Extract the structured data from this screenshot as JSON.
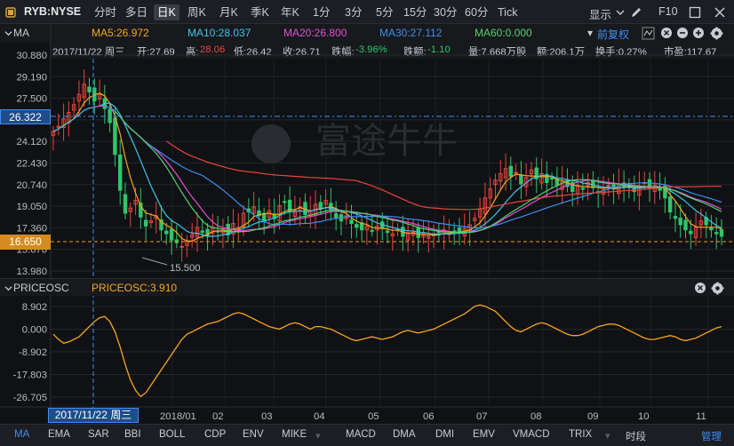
{
  "toolbar": {
    "symbol": "RYB:NYSE",
    "periods": [
      "分时",
      "多日",
      "日K",
      "周K",
      "月K",
      "季K",
      "年K",
      "1分",
      "3分",
      "5分",
      "15分",
      "30分",
      "60分",
      "Tick"
    ],
    "active_period": "日K",
    "display_label": "显示",
    "f10_label": "F10"
  },
  "ma_panel": {
    "label": "MA",
    "ma5": "MA5:26.972",
    "ma10": "MA10:28.037",
    "ma20": "MA20:26.800",
    "ma30": "MA30:27.112",
    "ma60": "MA60:0.000",
    "adjust": "前复权",
    "colors": {
      "ma5": "#f5a623",
      "ma10": "#3cc6e8",
      "ma20": "#e352d2",
      "ma30": "#3d8ef0",
      "ma60": "#53d26c",
      "up": "#e8453c",
      "down": "#2fc56b"
    }
  },
  "info": {
    "date": "2017/11/22 周三",
    "open": "开:27.69",
    "high_label": "高:",
    "high": "28.06",
    "low": "低:26.42",
    "close": "收:26.71",
    "change_pct_label": "跌幅:",
    "change_pct": "-3.96%",
    "change_label": "跌额:",
    "change": "-1.10",
    "volume": "量:7.668万股",
    "amount": "额:206.1万",
    "turnover": "换手:0.27%",
    "pe": "市盈:117.67"
  },
  "price_axis": [
    "30.880",
    "29.190",
    "27.500",
    "25.810",
    "24.120",
    "22.430",
    "20.740",
    "19.050",
    "17.360",
    "15.670",
    "13.980"
  ],
  "crosshair_price": "26.322",
  "last_price": "16.650",
  "low_annotation": "15.500",
  "osc_panel": {
    "label": "PRICEOSC",
    "value": "PRICEOSC:3.910",
    "axis": [
      "8.902",
      "0.000",
      "-8.902",
      "-17.803",
      "-26.705"
    ],
    "color": "#f5a623"
  },
  "time_axis": {
    "crosshair_date": "2017/11/22 周三",
    "labels": [
      "2018/01",
      "02",
      "03",
      "04",
      "05",
      "06",
      "07",
      "08",
      "09",
      "10",
      "11"
    ]
  },
  "indicators": [
    "MA",
    "EMA",
    "SAR",
    "BBI",
    "BOLL",
    "CDP",
    "ENV",
    "MIKE",
    "MACD",
    "DMA",
    "DMI",
    "EMV",
    "VMACD",
    "TRIX",
    "时段"
  ],
  "active_indicator": "MA",
  "manage_label": "管理",
  "watermark": "富途牛牛",
  "chart_data": {
    "type": "line",
    "ylim": [
      13.98,
      30.88
    ],
    "osc_ylim": [
      -26.705,
      8.902
    ],
    "close_series": [
      24.9,
      25.3,
      25.9,
      26.4,
      27.0,
      27.8,
      28.6,
      28.0,
      27.3,
      27.8,
      26.7,
      25.6,
      23.1,
      20.3,
      18.5,
      18.9,
      19.5,
      18.2,
      17.5,
      17.9,
      18.3,
      17.2,
      16.9,
      16.4,
      16.2,
      15.9,
      16.3,
      16.8,
      17.4,
      17.0,
      16.7,
      17.4,
      17.1,
      17.3,
      16.8,
      17.7,
      17.4,
      18.5,
      18.6,
      19.0,
      18.3,
      17.9,
      18.7,
      18.1,
      19.1,
      19.4,
      18.6,
      18.7,
      19.0,
      18.4,
      18.7,
      19.2,
      18.9,
      19.5,
      18.7,
      18.1,
      17.9,
      18.3,
      17.7,
      17.4,
      17.2,
      17.5,
      17.1,
      17.5,
      17.3,
      17.0,
      16.9,
      17.2,
      16.7,
      16.9,
      17.0,
      16.6,
      16.9,
      16.7,
      16.8,
      17.0,
      17.2,
      16.9,
      17.1,
      17.0,
      17.3,
      17.6,
      18.1,
      18.8,
      19.7,
      20.4,
      21.1,
      21.6,
      22.0,
      21.4,
      21.7,
      20.8,
      21.3,
      21.9,
      21.2,
      21.6,
      20.9,
      21.2,
      20.7,
      21.0,
      20.6,
      20.2,
      20.7,
      20.4,
      20.9,
      20.5,
      20.1,
      20.3,
      20.7,
      20.4,
      20.8,
      20.5,
      20.6,
      20.2,
      20.6,
      20.9,
      20.5,
      20.7,
      20.3,
      19.7,
      18.6,
      18.1,
      17.6,
      17.2,
      16.9,
      17.4,
      17.9,
      17.6,
      17.2,
      16.9,
      16.7
    ],
    "osc_series": [
      -2,
      -4,
      -5.5,
      -5,
      -4,
      -3,
      -1,
      1,
      3,
      4.5,
      5,
      3,
      -1,
      -7,
      -14,
      -20,
      -24,
      -26.5,
      -25,
      -22,
      -19,
      -16,
      -13,
      -10,
      -7,
      -4,
      -2,
      -1,
      0,
      1,
      2,
      2.5,
      3,
      4,
      5,
      6,
      6.5,
      6,
      5,
      4,
      3,
      2,
      1,
      0.5,
      0,
      1,
      2,
      2.5,
      2,
      1,
      0,
      1,
      1,
      0.5,
      0,
      -1,
      -2,
      -3,
      -4,
      -4.5,
      -4,
      -3.5,
      -3,
      -3.5,
      -4,
      -3.5,
      -3,
      -2,
      -1,
      -0.5,
      -1,
      -1.5,
      -1,
      -0.5,
      0,
      1,
      2,
      3,
      4,
      5,
      6,
      7.5,
      9,
      9.5,
      9,
      8,
      7,
      5,
      3,
      1,
      -0.5,
      -1,
      0,
      1,
      2,
      2.5,
      2,
      1,
      0,
      -1,
      -2,
      -2.5,
      -2.5,
      -2,
      -1,
      0,
      1,
      1.5,
      2,
      2,
      1.5,
      0.5,
      -0.5,
      -1.5,
      -2.5,
      -3.5,
      -4,
      -4,
      -3.5,
      -3,
      -2.5,
      -3,
      -4,
      -4.5,
      -4,
      -3.5,
      -2.5,
      -1.5,
      -0.5,
      0.5,
      1
    ]
  }
}
